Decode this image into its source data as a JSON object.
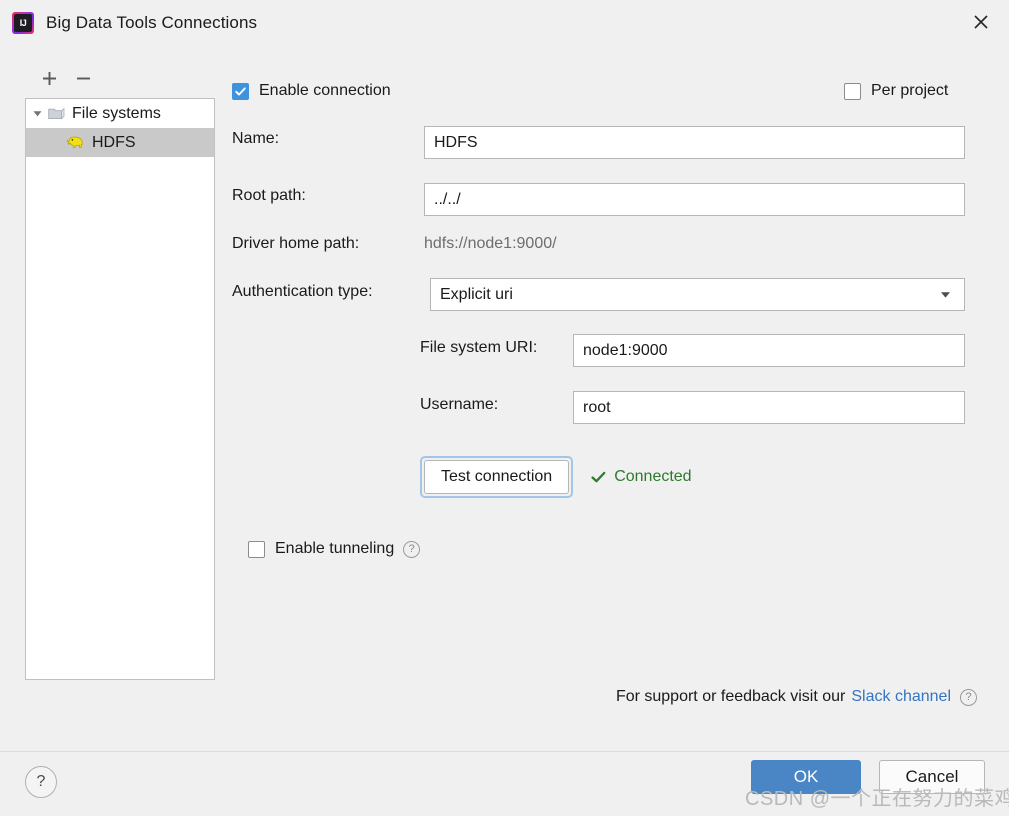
{
  "window": {
    "title": "Big Data Tools Connections",
    "app_icon": "intellij-idea-icon",
    "close_icon": "close-icon"
  },
  "sidebar": {
    "toolbar": {
      "add_label": "+",
      "remove_label": "−",
      "add_icon": "plus-icon",
      "remove_icon": "minus-icon"
    },
    "tree": [
      {
        "label": "File systems",
        "icon": "folder-icon",
        "expanded": true,
        "selected": false
      },
      {
        "label": "HDFS",
        "icon": "hadoop-elephant-icon",
        "expanded": false,
        "selected": true
      }
    ]
  },
  "form": {
    "enable_connection": {
      "label": "Enable connection",
      "checked": true
    },
    "per_project": {
      "label": "Per project",
      "checked": false
    },
    "name": {
      "label": "Name:",
      "value": "HDFS"
    },
    "root_path": {
      "label": "Root path:",
      "value": "../../"
    },
    "driver_home_path": {
      "label": "Driver home path:",
      "value": "hdfs://node1:9000/"
    },
    "authentication_type": {
      "label": "Authentication type:",
      "value": "Explicit uri",
      "arrow_icon": "chevron-down-icon"
    },
    "file_system_uri": {
      "label": "File system URI:",
      "value": "node1:9000"
    },
    "username": {
      "label": "Username:",
      "value": "root"
    },
    "test_connection": {
      "label": "Test connection"
    },
    "connection_status": {
      "text": "Connected",
      "icon": "checkmark-icon",
      "color": "#2d7a2d"
    },
    "enable_tunneling": {
      "label": "Enable tunneling",
      "checked": false,
      "help_icon": "question-mark-icon",
      "help_label": "?"
    }
  },
  "support": {
    "text": "For support or feedback visit our",
    "link_label": "Slack channel",
    "help_icon": "question-mark-icon",
    "help_label": "?"
  },
  "footer": {
    "help_label": "?",
    "help_icon": "question-mark-icon",
    "ok_label": "OK",
    "cancel_label": "Cancel"
  },
  "watermark": {
    "text": "CSDN @一个正在努力的菜鸡"
  },
  "colors": {
    "accent": "#4a86c5",
    "checkbox_checked": "#3f93dd",
    "link": "#3574c2",
    "success": "#2d7a2d",
    "window_bg": "#f0f0f0"
  }
}
